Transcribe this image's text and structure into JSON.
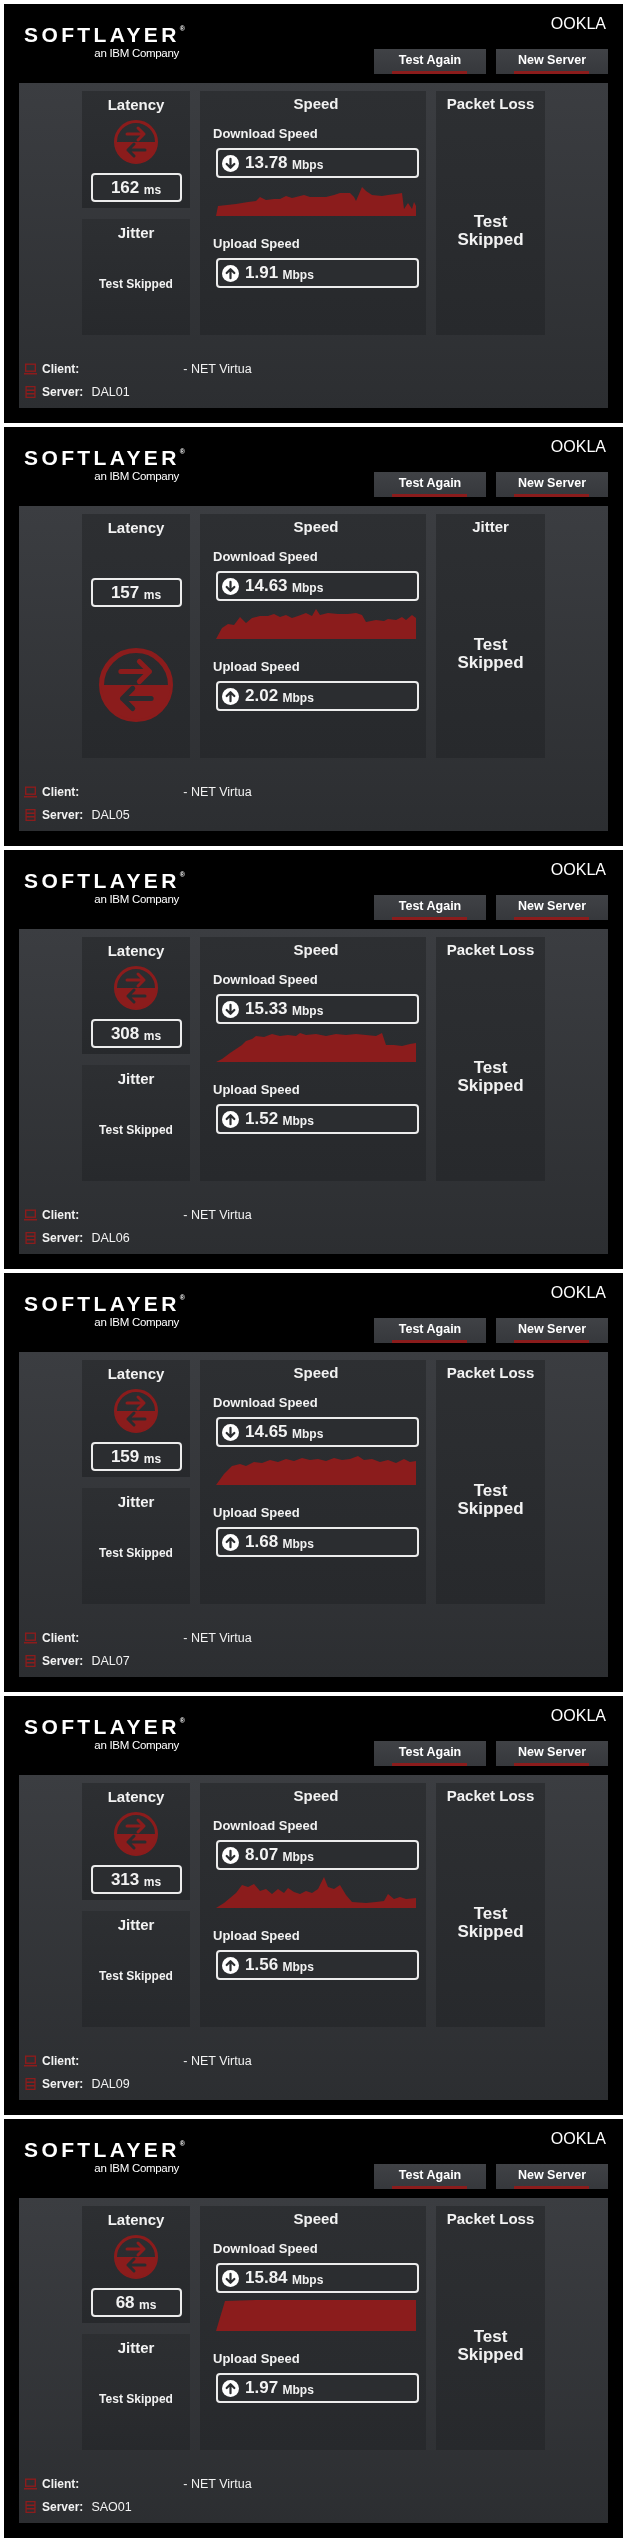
{
  "tests": [
    {
      "header": {
        "logo": "SOFTLAYER$^{®}$",
        "tagline": "an IBM Company",
        "brand": "OOKLA",
        "buttons": [
          "Test Again",
          "New Server"
        ]
      },
      "left_cards": [
        {
          "kind": "meter",
          "title": "Latency",
          "value": "162",
          "unit": "ms"
        },
        {
          "kind": "skipped",
          "title": "Jitter",
          "message": "Test Skipped"
        }
      ],
      "speed": {
        "title": "Speed",
        "download": {
          "label": "Download Speed",
          "value": "13.78",
          "unit": "Mbps"
        },
        "upload": {
          "label": "Upload Speed",
          "value": "1.91",
          "unit": "Mbps"
        }
      },
      "right_card": {
        "title": "Packet Loss",
        "message": "Test Skipped"
      },
      "info": [
        {
          "kind": "client",
          "label": "Client:",
          "value": "- NET Virtua"
        },
        {
          "kind": "server",
          "label": "Server:",
          "value": "DAL01"
        }
      ]
    },
    {
      "header": {
        "logo": "SOFTLAYER$^{®}$",
        "tagline": "an IBM Company",
        "brand": "OOKLA",
        "buttons": [
          "Test Again",
          "New Server"
        ]
      },
      "left_cards": [
        {
          "kind": "tall",
          "title": "Latency",
          "value": "157",
          "unit": "ms"
        }
      ],
      "speed": {
        "title": "Speed",
        "download": {
          "label": "Download Speed",
          "value": "14.63",
          "unit": "Mbps"
        },
        "upload": {
          "label": "Upload Speed",
          "value": "2.02",
          "unit": "Mbps"
        }
      },
      "right_card": {
        "title": "Jitter",
        "message": "Test Skipped"
      },
      "info": [
        {
          "kind": "client",
          "label": "Client:",
          "value": "- NET Virtua"
        },
        {
          "kind": "server",
          "label": "Server:",
          "value": "DAL05"
        }
      ]
    },
    {
      "header": {
        "logo": "SOFTLAYER$^{®}$",
        "tagline": "an IBM Company",
        "brand": "OOKLA",
        "buttons": [
          "Test Again",
          "New Server"
        ]
      },
      "left_cards": [
        {
          "kind": "meter",
          "title": "Latency",
          "value": "308",
          "unit": "ms"
        },
        {
          "kind": "skipped",
          "title": "Jitter",
          "message": "Test Skipped"
        }
      ],
      "speed": {
        "title": "Speed",
        "download": {
          "label": "Download Speed",
          "value": "15.33",
          "unit": "Mbps"
        },
        "upload": {
          "label": "Upload Speed",
          "value": "1.52",
          "unit": "Mbps"
        }
      },
      "right_card": {
        "title": "Packet Loss",
        "message": "Test Skipped"
      },
      "info": [
        {
          "kind": "client",
          "label": "Client:",
          "value": "- NET Virtua"
        },
        {
          "kind": "server",
          "label": "Server:",
          "value": "DAL06"
        }
      ]
    },
    {
      "header": {
        "logo": "SOFTLAYER$^{®}$",
        "tagline": "an IBM Company",
        "brand": "OOKLA",
        "buttons": [
          "Test Again",
          "New Server"
        ]
      },
      "left_cards": [
        {
          "kind": "meter",
          "title": "Latency",
          "value": "159",
          "unit": "ms"
        },
        {
          "kind": "skipped",
          "title": "Jitter",
          "message": "Test Skipped"
        }
      ],
      "speed": {
        "title": "Speed",
        "download": {
          "label": "Download Speed",
          "value": "14.65",
          "unit": "Mbps"
        },
        "upload": {
          "label": "Upload Speed",
          "value": "1.68",
          "unit": "Mbps"
        }
      },
      "right_card": {
        "title": "Packet Loss",
        "message": "Test Skipped"
      },
      "info": [
        {
          "kind": "client",
          "label": "Client:",
          "value": "- NET Virtua"
        },
        {
          "kind": "server",
          "label": "Server:",
          "value": "DAL07"
        }
      ]
    },
    {
      "header": {
        "logo": "SOFTLAYER$^{®}$",
        "tagline": "an IBM Company",
        "brand": "OOKLA",
        "buttons": [
          "Test Again",
          "New Server"
        ]
      },
      "left_cards": [
        {
          "kind": "meter",
          "title": "Latency",
          "value": "313",
          "unit": "ms"
        },
        {
          "kind": "skipped",
          "title": "Jitter",
          "message": "Test Skipped"
        }
      ],
      "speed": {
        "title": "Speed",
        "download": {
          "label": "Download Speed",
          "value": "8.07",
          "unit": "Mbps"
        },
        "upload": {
          "label": "Upload Speed",
          "value": "1.56",
          "unit": "Mbps"
        }
      },
      "right_card": {
        "title": "Packet Loss",
        "message": "Test Skipped"
      },
      "info": [
        {
          "kind": "client",
          "label": "Client:",
          "value": "- NET Virtua"
        },
        {
          "kind": "server",
          "label": "Server:",
          "value": "DAL09"
        }
      ]
    },
    {
      "header": {
        "logo": "SOFTLAYER$^{®}$",
        "tagline": "an IBM Company",
        "brand": "OOKLA",
        "buttons": [
          "Test Again",
          "New Server"
        ]
      },
      "left_cards": [
        {
          "kind": "meter",
          "title": "Latency",
          "value": "68",
          "unit": "ms"
        },
        {
          "kind": "skipped",
          "title": "Jitter",
          "message": "Test Skipped"
        }
      ],
      "speed": {
        "title": "Speed",
        "download": {
          "label": "Download Speed",
          "value": "15.84",
          "unit": "Mbps"
        },
        "upload": {
          "label": "Upload Speed",
          "value": "1.97",
          "unit": "Mbps"
        }
      },
      "right_card": {
        "title": "Packet Loss",
        "message": "Test Skipped"
      },
      "info": [
        {
          "kind": "client",
          "label": "Client:",
          "value": "- NET Virtua"
        },
        {
          "kind": "server",
          "label": "Server:",
          "value": "SAO01"
        }
      ]
    }
  ]
}
